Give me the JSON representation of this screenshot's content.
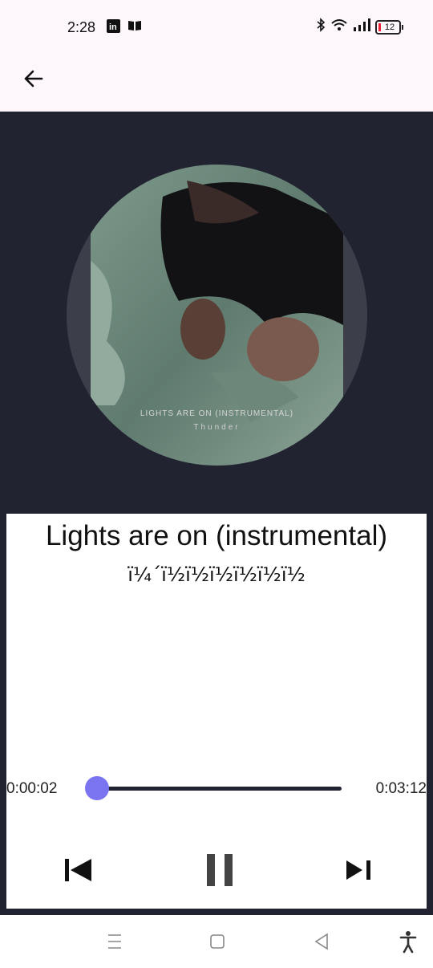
{
  "status_bar": {
    "time": "2:28",
    "battery_level": "12",
    "icons": [
      "linkedin-icon",
      "book-icon",
      "bluetooth-icon",
      "wifi-icon",
      "signal-icon",
      "battery-icon"
    ]
  },
  "app_bar": {
    "back_icon": "arrow-left-icon"
  },
  "album": {
    "art_line1": "LIGHTS ARE ON (INSTRUMENTAL)",
    "art_line2": "Thunder"
  },
  "player": {
    "title": "Lights are on (instrumental)",
    "artist": "ï¼´ï½ï½ï½ï½ï½ï½",
    "current_time": "0:00:02",
    "total_time": "0:03:12",
    "progress_fraction": 0.01,
    "colors": {
      "accent": "#7b74f0",
      "background": "#212330",
      "track": "#212330"
    }
  },
  "controls": {
    "previous_icon": "skip-previous-icon",
    "pause_icon": "pause-icon",
    "next_icon": "skip-next-icon"
  },
  "nav_bar": {
    "icons": [
      "recents-icon",
      "home-icon",
      "back-triangle-icon",
      "accessibility-icon"
    ]
  }
}
